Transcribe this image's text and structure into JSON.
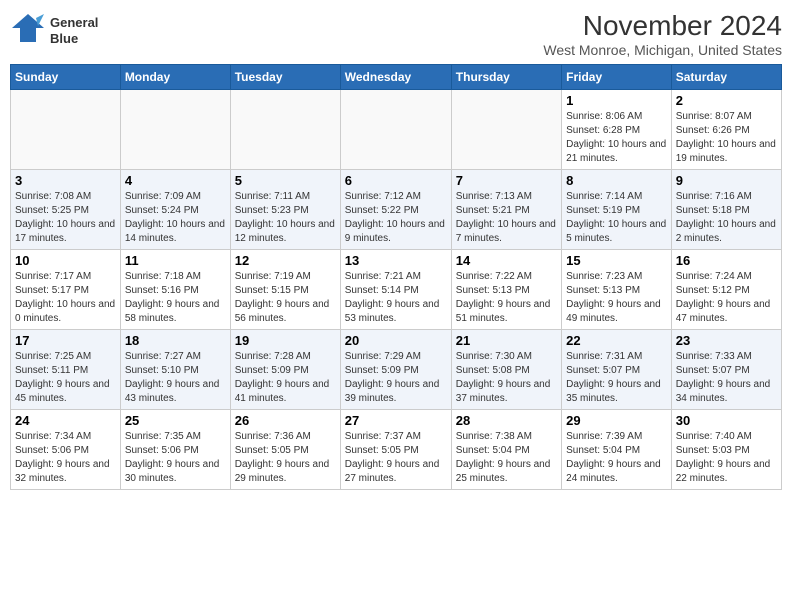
{
  "app": {
    "logo_line1": "General",
    "logo_line2": "Blue"
  },
  "calendar": {
    "title": "November 2024",
    "location": "West Monroe, Michigan, United States",
    "weekdays": [
      "Sunday",
      "Monday",
      "Tuesday",
      "Wednesday",
      "Thursday",
      "Friday",
      "Saturday"
    ],
    "weeks": [
      [
        {
          "day": "",
          "info": ""
        },
        {
          "day": "",
          "info": ""
        },
        {
          "day": "",
          "info": ""
        },
        {
          "day": "",
          "info": ""
        },
        {
          "day": "",
          "info": ""
        },
        {
          "day": "1",
          "info": "Sunrise: 8:06 AM\nSunset: 6:28 PM\nDaylight: 10 hours\nand 21 minutes."
        },
        {
          "day": "2",
          "info": "Sunrise: 8:07 AM\nSunset: 6:26 PM\nDaylight: 10 hours\nand 19 minutes."
        }
      ],
      [
        {
          "day": "3",
          "info": "Sunrise: 7:08 AM\nSunset: 5:25 PM\nDaylight: 10 hours\nand 17 minutes."
        },
        {
          "day": "4",
          "info": "Sunrise: 7:09 AM\nSunset: 5:24 PM\nDaylight: 10 hours\nand 14 minutes."
        },
        {
          "day": "5",
          "info": "Sunrise: 7:11 AM\nSunset: 5:23 PM\nDaylight: 10 hours\nand 12 minutes."
        },
        {
          "day": "6",
          "info": "Sunrise: 7:12 AM\nSunset: 5:22 PM\nDaylight: 10 hours\nand 9 minutes."
        },
        {
          "day": "7",
          "info": "Sunrise: 7:13 AM\nSunset: 5:21 PM\nDaylight: 10 hours\nand 7 minutes."
        },
        {
          "day": "8",
          "info": "Sunrise: 7:14 AM\nSunset: 5:19 PM\nDaylight: 10 hours\nand 5 minutes."
        },
        {
          "day": "9",
          "info": "Sunrise: 7:16 AM\nSunset: 5:18 PM\nDaylight: 10 hours\nand 2 minutes."
        }
      ],
      [
        {
          "day": "10",
          "info": "Sunrise: 7:17 AM\nSunset: 5:17 PM\nDaylight: 10 hours\nand 0 minutes."
        },
        {
          "day": "11",
          "info": "Sunrise: 7:18 AM\nSunset: 5:16 PM\nDaylight: 9 hours\nand 58 minutes."
        },
        {
          "day": "12",
          "info": "Sunrise: 7:19 AM\nSunset: 5:15 PM\nDaylight: 9 hours\nand 56 minutes."
        },
        {
          "day": "13",
          "info": "Sunrise: 7:21 AM\nSunset: 5:14 PM\nDaylight: 9 hours\nand 53 minutes."
        },
        {
          "day": "14",
          "info": "Sunrise: 7:22 AM\nSunset: 5:13 PM\nDaylight: 9 hours\nand 51 minutes."
        },
        {
          "day": "15",
          "info": "Sunrise: 7:23 AM\nSunset: 5:13 PM\nDaylight: 9 hours\nand 49 minutes."
        },
        {
          "day": "16",
          "info": "Sunrise: 7:24 AM\nSunset: 5:12 PM\nDaylight: 9 hours\nand 47 minutes."
        }
      ],
      [
        {
          "day": "17",
          "info": "Sunrise: 7:25 AM\nSunset: 5:11 PM\nDaylight: 9 hours\nand 45 minutes."
        },
        {
          "day": "18",
          "info": "Sunrise: 7:27 AM\nSunset: 5:10 PM\nDaylight: 9 hours\nand 43 minutes."
        },
        {
          "day": "19",
          "info": "Sunrise: 7:28 AM\nSunset: 5:09 PM\nDaylight: 9 hours\nand 41 minutes."
        },
        {
          "day": "20",
          "info": "Sunrise: 7:29 AM\nSunset: 5:09 PM\nDaylight: 9 hours\nand 39 minutes."
        },
        {
          "day": "21",
          "info": "Sunrise: 7:30 AM\nSunset: 5:08 PM\nDaylight: 9 hours\nand 37 minutes."
        },
        {
          "day": "22",
          "info": "Sunrise: 7:31 AM\nSunset: 5:07 PM\nDaylight: 9 hours\nand 35 minutes."
        },
        {
          "day": "23",
          "info": "Sunrise: 7:33 AM\nSunset: 5:07 PM\nDaylight: 9 hours\nand 34 minutes."
        }
      ],
      [
        {
          "day": "24",
          "info": "Sunrise: 7:34 AM\nSunset: 5:06 PM\nDaylight: 9 hours\nand 32 minutes."
        },
        {
          "day": "25",
          "info": "Sunrise: 7:35 AM\nSunset: 5:06 PM\nDaylight: 9 hours\nand 30 minutes."
        },
        {
          "day": "26",
          "info": "Sunrise: 7:36 AM\nSunset: 5:05 PM\nDaylight: 9 hours\nand 29 minutes."
        },
        {
          "day": "27",
          "info": "Sunrise: 7:37 AM\nSunset: 5:05 PM\nDaylight: 9 hours\nand 27 minutes."
        },
        {
          "day": "28",
          "info": "Sunrise: 7:38 AM\nSunset: 5:04 PM\nDaylight: 9 hours\nand 25 minutes."
        },
        {
          "day": "29",
          "info": "Sunrise: 7:39 AM\nSunset: 5:04 PM\nDaylight: 9 hours\nand 24 minutes."
        },
        {
          "day": "30",
          "info": "Sunrise: 7:40 AM\nSunset: 5:03 PM\nDaylight: 9 hours\nand 22 minutes."
        }
      ]
    ]
  }
}
